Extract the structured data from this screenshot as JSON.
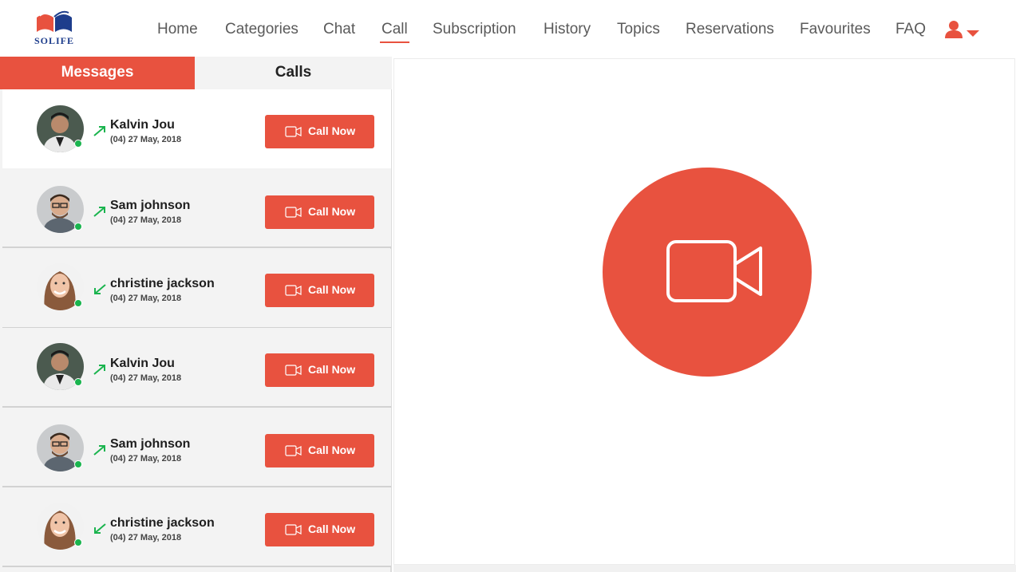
{
  "brand": {
    "logo_text": "SOLIFE",
    "accent_color": "#e8523f",
    "secondary_color": "#1d3d8c"
  },
  "nav": {
    "items": [
      {
        "label": "Home"
      },
      {
        "label": "Categories"
      },
      {
        "label": "Chat"
      },
      {
        "label": "Call",
        "active": true
      },
      {
        "label": "Subscription"
      },
      {
        "label": "History"
      },
      {
        "label": "Topics"
      },
      {
        "label": "Reservations"
      },
      {
        "label": "Favourites"
      },
      {
        "label": "FAQ"
      }
    ],
    "user_icon": "user-icon",
    "dropdown_icon": "caret-down-icon"
  },
  "tabs": {
    "messages": "Messages",
    "calls": "Calls",
    "active": "messages"
  },
  "calls": [
    {
      "name": "Kalvin Jou",
      "date": "(04) 27 May, 2018",
      "direction": "outgoing",
      "button": "Call Now",
      "online": true
    },
    {
      "name": "Sam johnson",
      "date": "(04) 27 May, 2018",
      "direction": "outgoing",
      "button": "Call Now",
      "online": true
    },
    {
      "name": "christine jackson",
      "date": "(04) 27 May, 2018",
      "direction": "incoming",
      "button": "Call Now",
      "online": true
    },
    {
      "name": "Kalvin Jou",
      "date": "(04) 27 May, 2018",
      "direction": "outgoing",
      "button": "Call Now",
      "online": true
    },
    {
      "name": "Sam johnson",
      "date": "(04) 27 May, 2018",
      "direction": "outgoing",
      "button": "Call Now",
      "online": true
    },
    {
      "name": "christine jackson",
      "date": "(04) 27 May, 2018",
      "direction": "incoming",
      "button": "Call Now",
      "online": true
    }
  ],
  "colors": {
    "online": "#1ab44e",
    "call_arrow": "#1ab44e",
    "button": "#e8523f"
  },
  "main": {
    "video_call_icon": "video-camera-icon"
  }
}
